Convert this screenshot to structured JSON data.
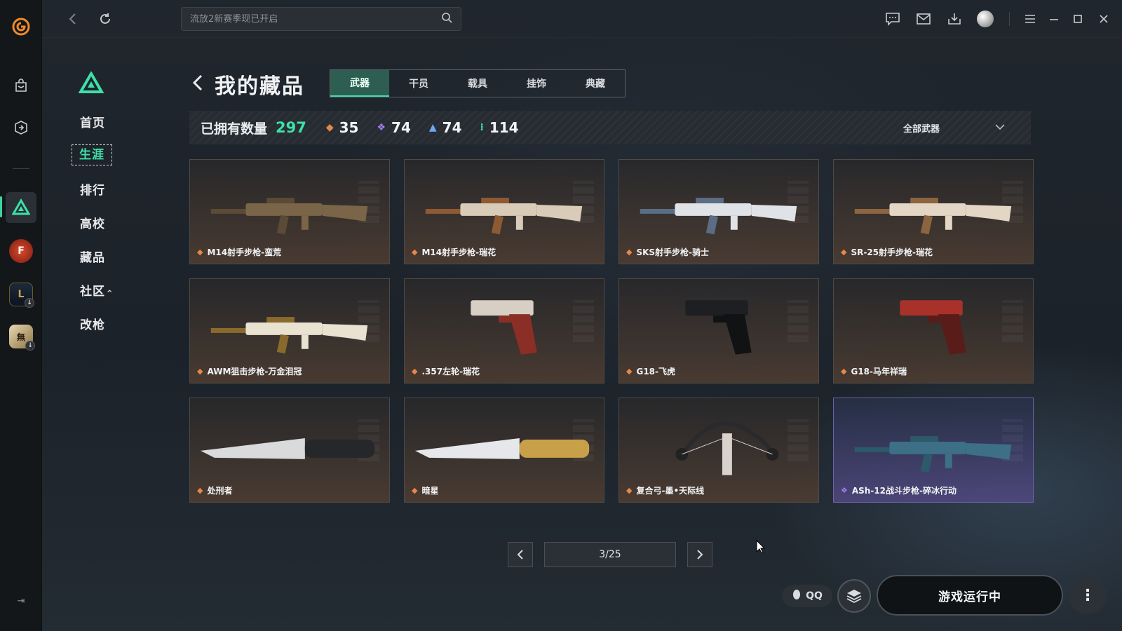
{
  "search": {
    "placeholder": "流放2新赛季现已开启"
  },
  "side_menu": {
    "items": [
      {
        "label": "首页",
        "name": "side-item-home"
      },
      {
        "label": "生涯",
        "name": "side-item-career",
        "active": true
      },
      {
        "label": "排行",
        "name": "side-item-ranking"
      },
      {
        "label": "高校",
        "name": "side-item-college"
      },
      {
        "label": "藏品",
        "name": "side-item-collection"
      },
      {
        "label": "社区",
        "name": "side-item-community",
        "caret": "^"
      },
      {
        "label": "改枪",
        "name": "side-item-gunsmith"
      }
    ]
  },
  "header": {
    "title": "我的藏品"
  },
  "tabs": [
    {
      "label": "武器",
      "active": true
    },
    {
      "label": "干员"
    },
    {
      "label": "载具"
    },
    {
      "label": "挂饰"
    },
    {
      "label": "典藏"
    }
  ],
  "summary": {
    "label": "已拥有数量",
    "total": "297",
    "rarity_counts": [
      {
        "rarity": "orange",
        "value": "35"
      },
      {
        "rarity": "purple",
        "value": "74"
      },
      {
        "rarity": "blue",
        "value": "74"
      },
      {
        "rarity": "green",
        "value": "114"
      }
    ],
    "filter": "全部武器"
  },
  "items": [
    {
      "name": "M14射手步枪-蛮荒",
      "rarity": "orange"
    },
    {
      "name": "M14射手步枪-瑞花",
      "rarity": "orange"
    },
    {
      "name": "SKS射手步枪-骑士",
      "rarity": "orange"
    },
    {
      "name": "SR-25射手步枪-瑞花",
      "rarity": "orange"
    },
    {
      "name": "AWM狙击步枪-万金泪冠",
      "rarity": "orange"
    },
    {
      "name": ".357左轮-瑞花",
      "rarity": "orange"
    },
    {
      "name": "G18-飞虎",
      "rarity": "orange"
    },
    {
      "name": "G18-马年祥瑞",
      "rarity": "orange"
    },
    {
      "name": "处刑者",
      "rarity": "orange"
    },
    {
      "name": "暗星",
      "rarity": "orange"
    },
    {
      "name": "复合弓-墨•天际线",
      "rarity": "orange"
    },
    {
      "name": "ASh-12战斗步枪-碎冰行动",
      "rarity": "purple"
    }
  ],
  "pager": {
    "label": "3/25"
  },
  "bottom": {
    "qq_label": "QQ",
    "launch_label": "游戏运行中"
  },
  "colors": {
    "accent": "#3ee0a8",
    "orange": "#e7874a",
    "purple": "#a57cf0",
    "blue": "#6fa7f2"
  }
}
